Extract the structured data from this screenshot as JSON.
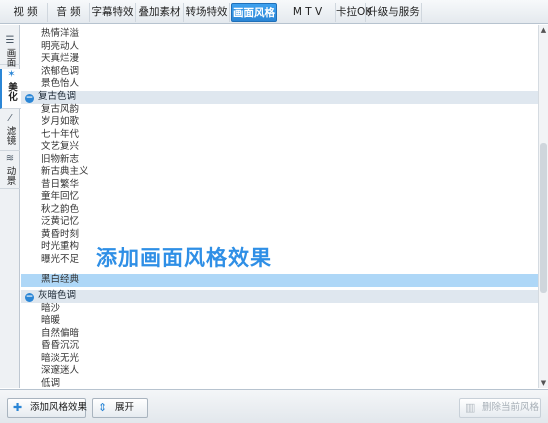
{
  "tabs": [
    {
      "label": "视 频",
      "active": false
    },
    {
      "label": "音 频",
      "active": false
    },
    {
      "label": "字幕特效",
      "active": false
    },
    {
      "label": "叠加素材",
      "active": false
    },
    {
      "label": "转场特效",
      "active": false
    },
    {
      "label": "画面风格",
      "active": true
    },
    {
      "label": "M T V",
      "active": false
    },
    {
      "label": "卡拉OK",
      "active": false
    },
    {
      "label": "升级与服务",
      "active": false
    }
  ],
  "side_tabs": [
    {
      "label": "画面",
      "icon": "list-icon"
    },
    {
      "label": "美化",
      "icon": "magic-wand-icon"
    },
    {
      "label": "滤镜",
      "icon": "filter-wand-icon"
    },
    {
      "label": "动景",
      "icon": "waves-icon"
    }
  ],
  "list": {
    "top_items": [
      "热情洋溢",
      "明亮动人",
      "天真烂漫",
      "浓郁色调",
      "景色怡人"
    ],
    "group1": {
      "label": "复古色调",
      "items": [
        "复古风韵",
        "岁月如歌",
        "七十年代",
        "文艺复兴",
        "旧物新志",
        "新古典主义",
        "昔日繁华",
        "童年回忆",
        "秋之韵色",
        "泛黄记忆",
        "黄昏时刻",
        "时光重构",
        "曝光不足",
        "黑白经典"
      ]
    },
    "group2": {
      "label": "灰暗色调",
      "items": [
        "暗沙",
        "暗暖",
        "自然偏暗",
        "昏昏沉沉",
        "暗淡无光",
        "深邃迷人",
        "低调"
      ]
    },
    "selected": "黑白经典"
  },
  "overlay_text": "添加画面风格效果",
  "buttons": {
    "add": "添加风格效果",
    "expand": "展开",
    "delete": "删除当前风格"
  },
  "colors": {
    "accent": "#2b86d6",
    "selected_row": "#aed7f7",
    "overlay": "#2f8fe6"
  }
}
